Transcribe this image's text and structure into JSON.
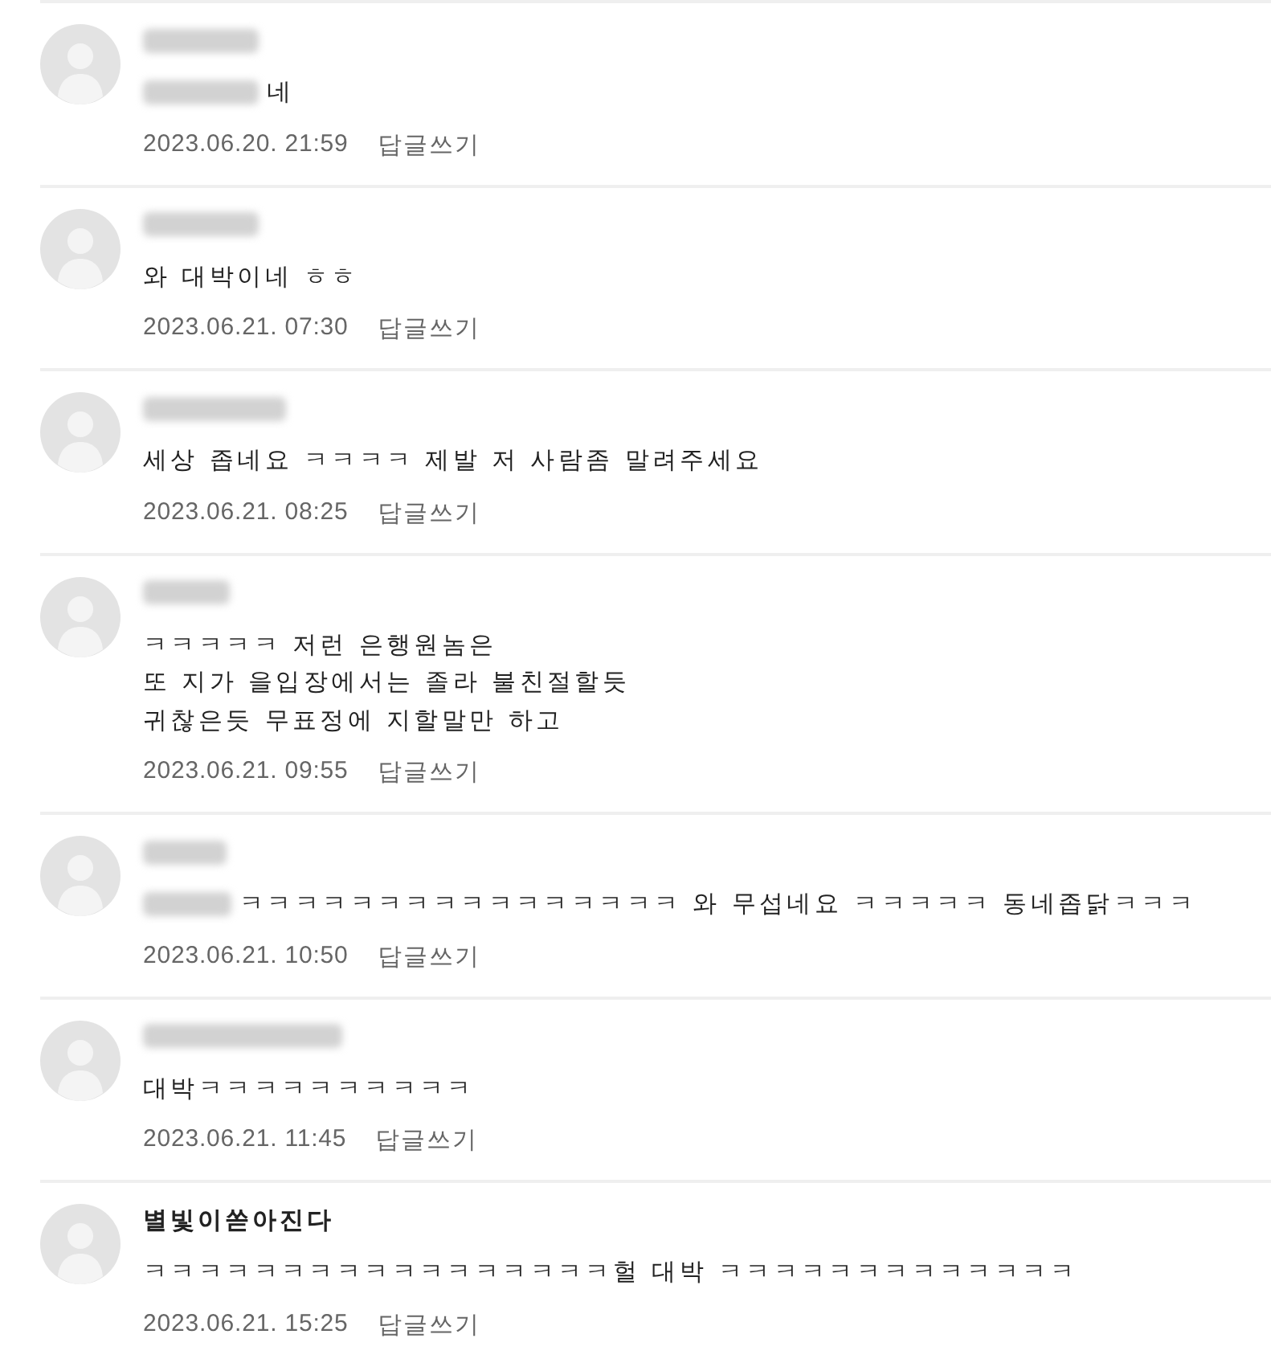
{
  "comments": [
    {
      "author_blurred": true,
      "mention_blurred": true,
      "text": "네",
      "date": "2023.06.20. 21:59",
      "reply": "답글쓰기"
    },
    {
      "author_blurred": true,
      "mention_blurred": false,
      "text": "와 대박이네 ㅎㅎ",
      "date": "2023.06.21. 07:30",
      "reply": "답글쓰기"
    },
    {
      "author_blurred": true,
      "mention_blurred": false,
      "text": "세상 좁네요 ㅋㅋㅋㅋ 제발 저 사람좀 말려주세요",
      "date": "2023.06.21. 08:25",
      "reply": "답글쓰기"
    },
    {
      "author_blurred": true,
      "mention_blurred": false,
      "text": "ㅋㅋㅋㅋㅋ 저런 은행원놈은\n또 지가 을입장에서는 졸라 불친절할듯\n귀찮은듯 무표정에 지할말만 하고",
      "date": "2023.06.21. 09:55",
      "reply": "답글쓰기"
    },
    {
      "author_blurred": true,
      "mention_blurred": true,
      "text": "ㅋㅋㅋㅋㅋㅋㅋㅋㅋㅋㅋㅋㅋㅋㅋㅋ 와 무섭네요 ㅋㅋㅋㅋㅋ 동네좁닭ㅋㅋㅋ",
      "date": "2023.06.21. 10:50",
      "reply": "답글쓰기"
    },
    {
      "author_blurred": true,
      "mention_blurred": false,
      "text": "대박ㅋㅋㅋㅋㅋㅋㅋㅋㅋㅋ",
      "date": "2023.06.21. 11:45",
      "reply": "답글쓰기"
    },
    {
      "author": "별빛이쏟아진다",
      "author_blurred": false,
      "mention_blurred": false,
      "text": "ㅋㅋㅋㅋㅋㅋㅋㅋㅋㅋㅋㅋㅋㅋㅋㅋㅋ헐 대박 ㅋㅋㅋㅋㅋㅋㅋㅋㅋㅋㅋㅋㅋ",
      "date": "2023.06.21. 15:25",
      "reply": "답글쓰기"
    }
  ]
}
